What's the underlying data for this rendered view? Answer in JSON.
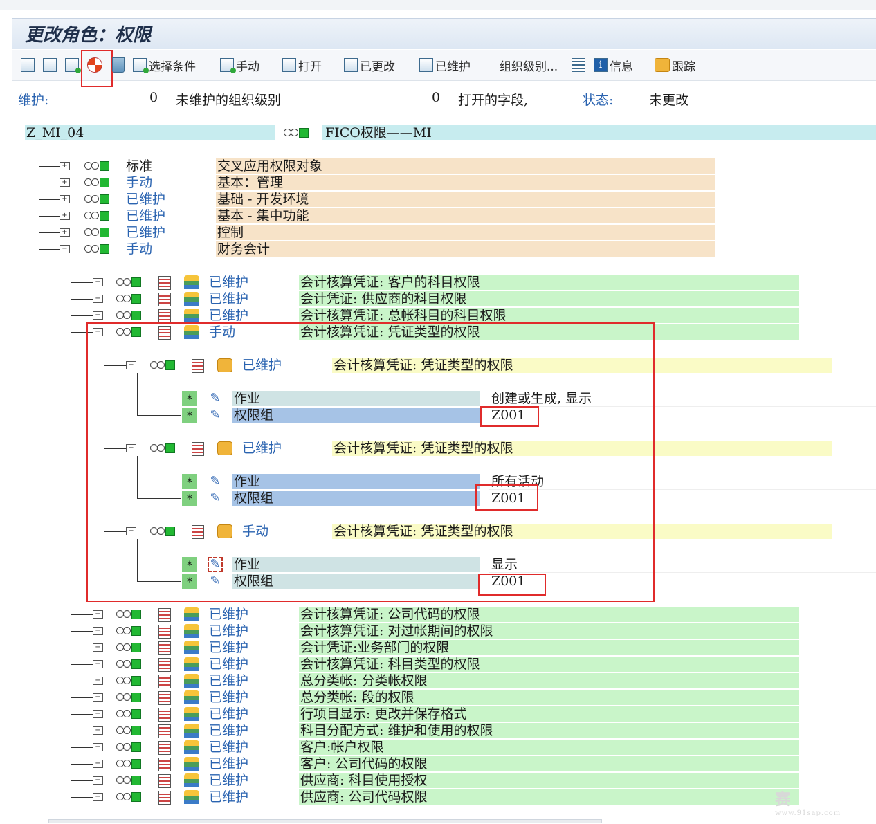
{
  "title": "更改角色：权限",
  "toolbar": {
    "items": [
      {
        "label": "选择条件"
      },
      {
        "label": "手动"
      },
      {
        "label": "打开"
      },
      {
        "label": "已更改"
      },
      {
        "label": "已维护"
      },
      {
        "label": "组织级别..."
      },
      {
        "label": ""
      },
      {
        "label": "信息"
      },
      {
        "label": "跟踪"
      }
    ]
  },
  "status": {
    "maintain_label": "维护:",
    "unmaintained_count": "0",
    "unmaintained_label": "未维护的组织级别",
    "open_count": "0",
    "open_label": "打开的字段,",
    "state_label": "状态:",
    "state_value": "未更改"
  },
  "role": {
    "name": "Z_MI_04",
    "description": "FICO权限——MI"
  },
  "level1": [
    {
      "status": "标准",
      "text": "交叉应用权限对象"
    },
    {
      "status": "手动",
      "text": "基本：管理"
    },
    {
      "status": "已维护",
      "text": "基础 -  开发环境"
    },
    {
      "status": "已维护",
      "text": "基本 - 集中功能"
    },
    {
      "status": "已维护",
      "text": "控制"
    },
    {
      "status": "手动",
      "text": "财务会计"
    }
  ],
  "level2_top": [
    {
      "status": "已维护",
      "text": "会计核算凭证: 客户的科目权限"
    },
    {
      "status": "已维护",
      "text": "会计凭证: 供应商的科目权限"
    },
    {
      "status": "已维护",
      "text": "会计核算凭证: 总帐科目的科目权限"
    },
    {
      "status": "手动",
      "text": "会计核算凭证: 凭证类型的权限"
    }
  ],
  "auth_groups": [
    {
      "status": "已维护",
      "text": "会计核算凭证: 凭证类型的权限",
      "fields": [
        {
          "name": "作业",
          "value": "创建或生成, 显示"
        },
        {
          "name": "权限组",
          "value": "Z001"
        }
      ]
    },
    {
      "status": "已维护",
      "text": "会计核算凭证: 凭证类型的权限",
      "fields": [
        {
          "name": "作业",
          "value": "所有活动"
        },
        {
          "name": "权限组",
          "value": "Z001"
        }
      ]
    },
    {
      "status": "手动",
      "text": "会计核算凭证: 凭证类型的权限",
      "fields": [
        {
          "name": "作业",
          "value": "显示"
        },
        {
          "name": "权限组",
          "value": "Z001"
        }
      ]
    }
  ],
  "level2_bottom": [
    {
      "status": "已维护",
      "text": "会计核算凭证: 公司代码的权限"
    },
    {
      "status": "已维护",
      "text": "会计核算凭证: 对过帐期间的权限"
    },
    {
      "status": "已维护",
      "text": "会计凭证:业务部门的权限"
    },
    {
      "status": "已维护",
      "text": "会计核算凭证: 科目类型的权限"
    },
    {
      "status": "已维护",
      "text": "总分类帐: 分类帐权限"
    },
    {
      "status": "已维护",
      "text": "总分类帐: 段的权限"
    },
    {
      "status": "已维护",
      "text": "行项目显示: 更改并保存格式"
    },
    {
      "status": "已维护",
      "text": "科目分配方式: 维护和使用的权限"
    },
    {
      "status": "已维护",
      "text": "客户:帐户权限"
    },
    {
      "status": "已维护",
      "text": "客户: 公司代码的权限"
    },
    {
      "status": "已维护",
      "text": "供应商: 科目使用授权"
    },
    {
      "status": "已维护",
      "text": "供应商: 公司代码权限"
    }
  ],
  "watermark": {
    "name": "赛 "
  },
  "colors": {
    "highlight": "#e02b2b",
    "accent_blue": "#2a63b0",
    "manual_text": "#2a63b0"
  }
}
